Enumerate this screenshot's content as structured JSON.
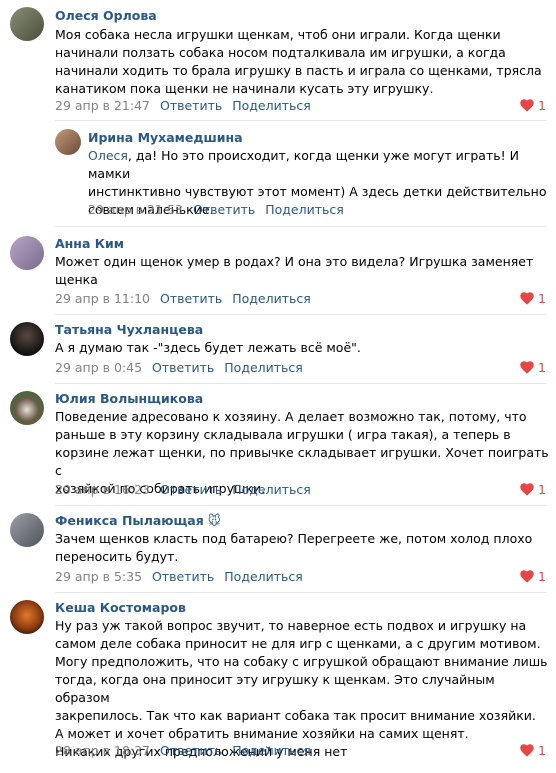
{
  "colors": {
    "link": "#2a5885",
    "meta": "#828282",
    "heart": "#e64646",
    "divider": "#e7e8ec"
  },
  "actions": {
    "reply": "Ответить",
    "share": "Поделиться"
  },
  "comments": [
    {
      "name": "Олеся Орлова",
      "text": "Моя собака несла игрушки щенкам, чтоб они играли. Когда щенки\nначинали ползать собака носом подталкивала им игрушки, а когда\nначинали ходить то брала игрушку в пасть и играла со щенками, трясла\nканатиком пока щенки не начинали кусать эту игрушку.",
      "date": "29 апр в 21:47",
      "likes": "1",
      "avatar_icon": "avatar-photo"
    },
    {
      "name": "Ирина Мухамедшина",
      "mention": "Олеся",
      "text": ", да! Но это происходит, когда щенки уже могут играть! И мамки\nинстинктивно чувствуют этот момент) А здесь детки действительно\nсовсем маленькие.",
      "date": "29 апр в 21:53",
      "likes": "",
      "avatar_icon": "avatar-photo"
    },
    {
      "name": "Анна Ким",
      "text": "Может один щенок умер в родах? И она это видела? Игрушка заменяет\nщенка",
      "date": "29 апр в 11:10",
      "likes": "1",
      "avatar_icon": "avatar-photo"
    },
    {
      "name": "Татьяна Чухланцева",
      "text": "А я думаю так -\"здесь будет лежать всё моё\".",
      "date": "29 апр в 0:45",
      "likes": "1",
      "avatar_icon": "avatar-photo"
    },
    {
      "name": "Юлия Волынщикова",
      "text": "Поведение адресовано к хозяину. А делает возможно так, потому, что\nраньше в эту корзину складывала игрушки ( игра такая), а теперь в\nкорзине лежат щенки, по привычке складывает игрушки. Хочет поиграть с\nхозяйкой по собирать игрушки.",
      "date": "29 апр в 16:23",
      "likes": "1",
      "avatar_icon": "avatar-photo"
    },
    {
      "name": "Феникса Пылающая",
      "name_emoji": "🐭",
      "text": "Зачем щенков класть под батарею? Перегреете же, потом холод плохо\nпереносить будут.",
      "date": "29 апр в 5:35",
      "likes": "1",
      "avatar_icon": "avatar-photo"
    },
    {
      "name": "Кеша Костомаров",
      "text": "Ну раз уж такой вопрос звучит, то наверное есть подвох и игрушку на\nсамом деле собака приносит не для игр с щенками, а с другим мотивом.\nМогу предположить, что на собаку с игрушкой обращают внимание лишь\nтогда, когда она приносит эту игрушку к щенкам. Это случайным образом\nзакрепилось. Так что как вариант собака так просит внимание хозяйки.\nА может и хочет обратить внимание хозяйки на самих щенят.\nНикаких других предположений у меня нет",
      "date": "28 апр в 18:37",
      "likes": "1",
      "avatar_icon": "avatar-photo"
    }
  ]
}
